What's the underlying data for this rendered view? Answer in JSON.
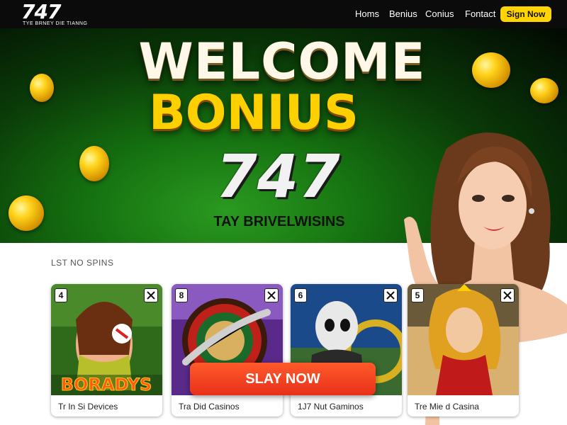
{
  "nav": {
    "logo_number": "747",
    "logo_tagline": "TYE BRNEY DIE TIANNG",
    "links": [
      "Homs",
      "Benius",
      "Conius",
      "Fontact"
    ],
    "cta_label": "Sign Now"
  },
  "hero": {
    "line1": "WELCOME",
    "line2": "BONIUS",
    "line3": "747",
    "line4": "TAY BRIVELWISINS"
  },
  "section": {
    "label": "LST NO SPINS"
  },
  "cards": [
    {
      "number": "4",
      "title": "Tr In Si Devices",
      "art_text": "BORADYS"
    },
    {
      "number": "8",
      "title": "Tra Did Casinos"
    },
    {
      "number": "6",
      "title": "1J7 Nut Gaminos"
    },
    {
      "number": "5",
      "title": "Tre Mie d Casina"
    }
  ],
  "play_button": "SLAY NOW",
  "colors": {
    "nav_bg": "#0b0b0b",
    "cta": "#ffd400",
    "play": "#ff4a1a",
    "gold": "#ffd000"
  },
  "icons": [
    "close-icon",
    "coin-icon"
  ]
}
